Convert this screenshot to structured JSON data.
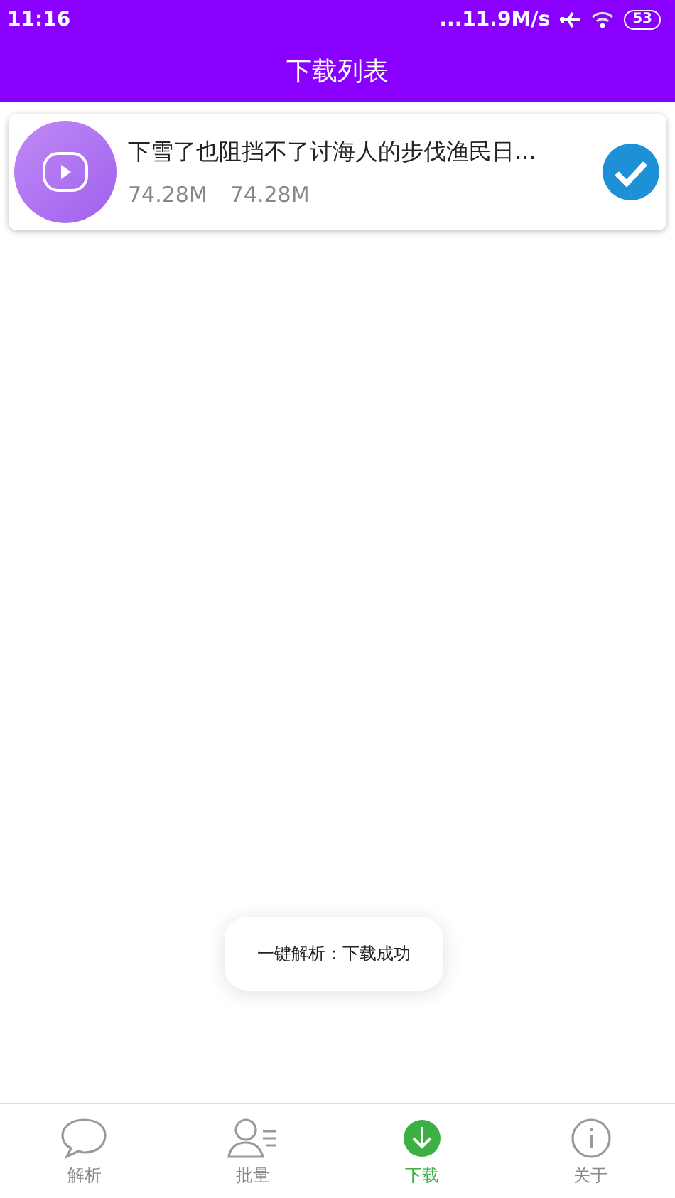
{
  "status_bar": {
    "time": "11:16",
    "speed": "...11.9M/s",
    "battery": "53"
  },
  "header": {
    "title": "下载列表"
  },
  "downloads": [
    {
      "title": "下雪了也阻挡不了讨海人的步伐渔民日...",
      "size_done": "74.28M",
      "size_total": "74.28M",
      "completed": true
    }
  ],
  "toast": {
    "text": "一键解析：下载成功"
  },
  "tabs": [
    {
      "label": "解析",
      "selected": false
    },
    {
      "label": "批量",
      "selected": false
    },
    {
      "label": "下载",
      "selected": true
    },
    {
      "label": "关于",
      "selected": false
    }
  ]
}
